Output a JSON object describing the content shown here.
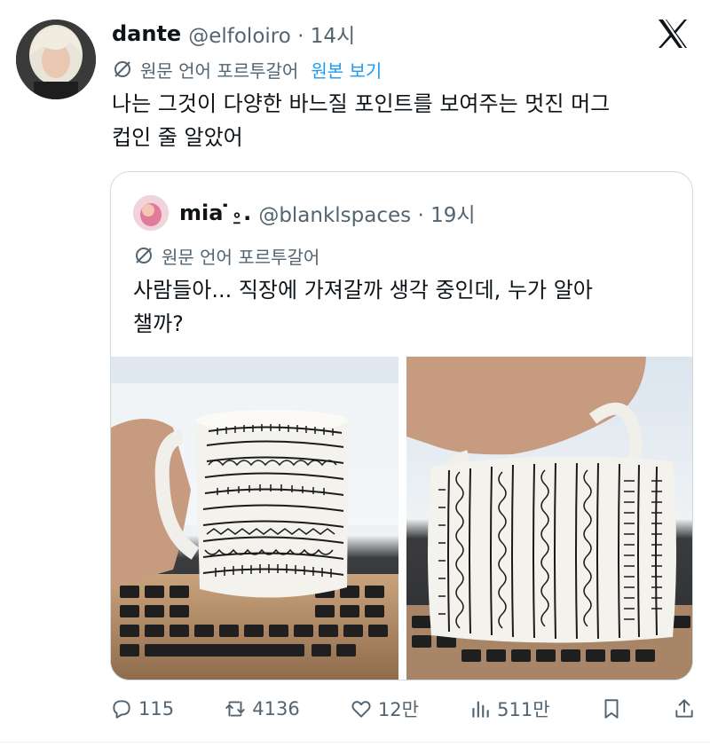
{
  "tweet": {
    "display_name": "dante",
    "handle_time": "@elfoloiro · 14시",
    "translate_label": "원문 언어 포르투갈어",
    "show_original": "원본 보기",
    "text_line1": "나는 그것이 다양한 바느질 포인트를 보여주는 멋진 머그",
    "text_line2": "컵인 줄 알았어"
  },
  "quote": {
    "display_name": "mia ̇⍛.",
    "handle_time": "@blanklspaces · 19시",
    "translate_label": "원문 언어 포르투갈어",
    "text_line1": "사람들아... 직장에 가져갈까 생각 중인데, 누가 알아",
    "text_line2": "챌까?"
  },
  "actions": {
    "replies": "115",
    "reposts": "4136",
    "likes": "12만",
    "views": "511만"
  },
  "icons": [
    "x-logo-icon",
    "translate-icon",
    "reply-icon",
    "repost-icon",
    "like-icon",
    "views-icon",
    "bookmark-icon",
    "share-icon"
  ],
  "colors": {
    "link": "#1d9bf0",
    "secondary_text": "#536471",
    "border": "#cfd9de"
  }
}
